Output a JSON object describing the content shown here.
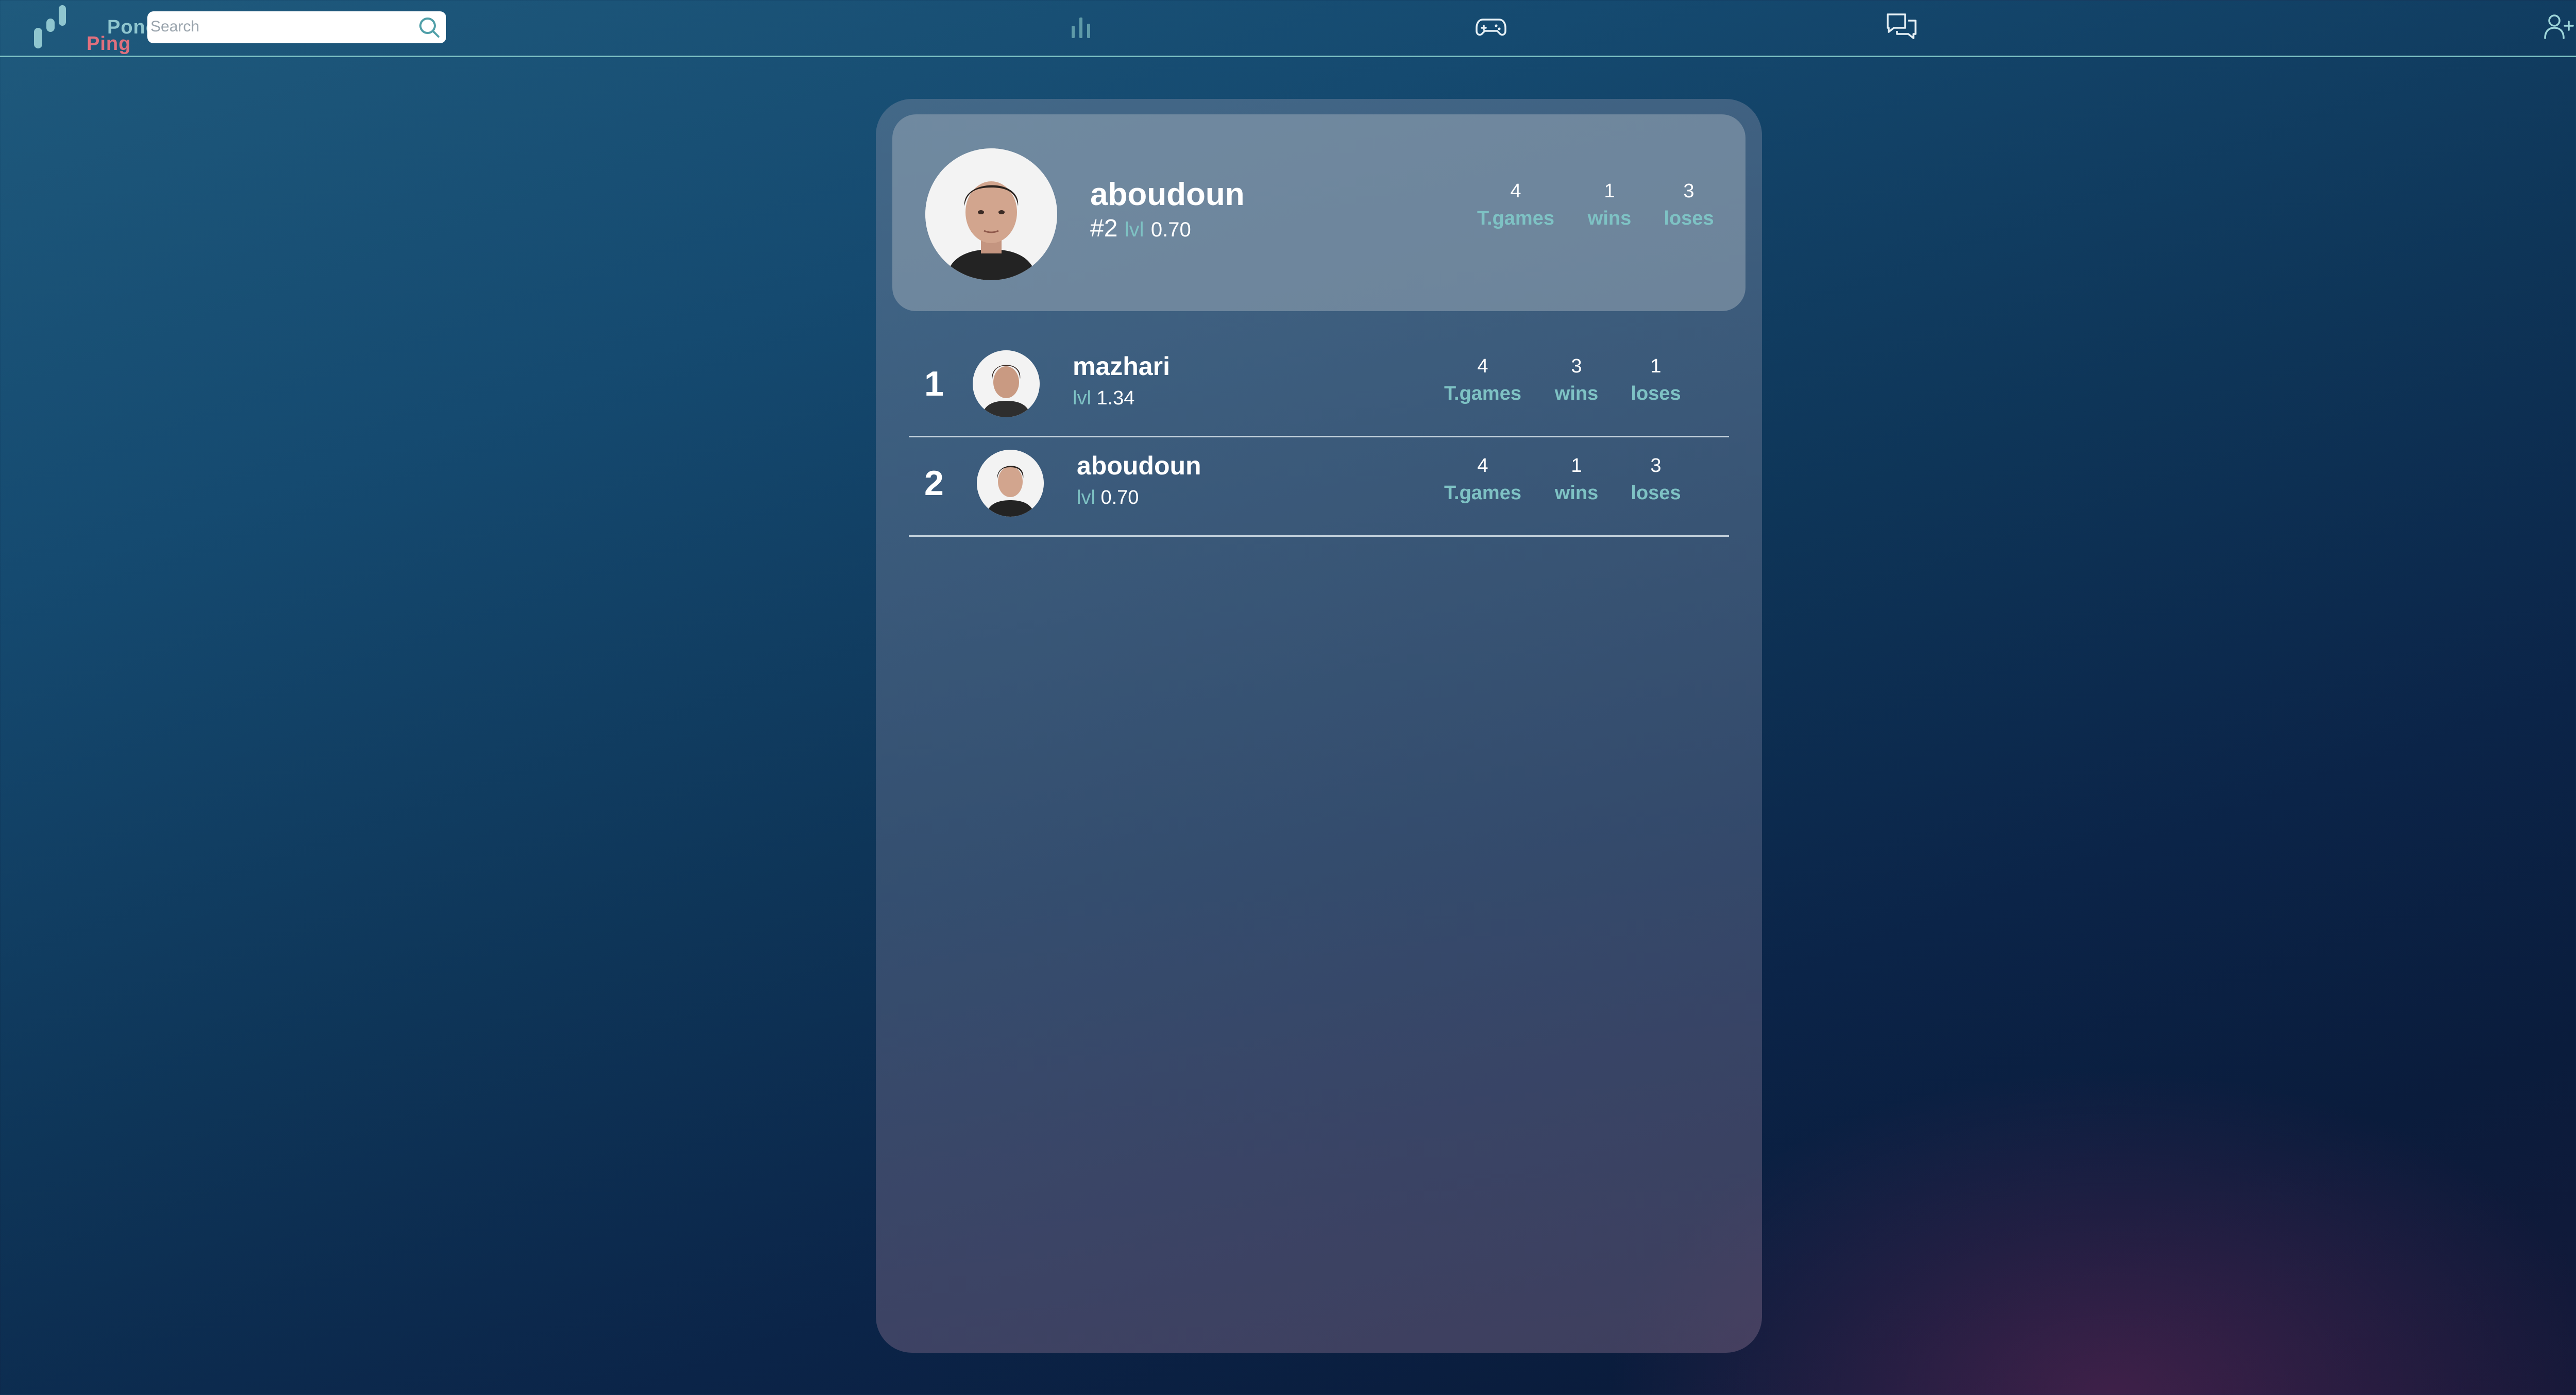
{
  "brand": {
    "line1": "Pong",
    "line2": "Ping"
  },
  "search": {
    "placeholder": "Search"
  },
  "nav": {
    "icons": [
      "stats-icon",
      "gamepad-icon",
      "chat-icon",
      "add-friend-icon",
      "user-avatar"
    ]
  },
  "me": {
    "name": "aboudoun",
    "rank": "#2",
    "lvl_label": "lvl",
    "lvl": "0.70",
    "stats": {
      "games": "4",
      "wins": "1",
      "loses": "3"
    }
  },
  "labels": {
    "games": "T.games",
    "wins": "wins",
    "loses": "loses"
  },
  "leaderboard": [
    {
      "rank": "1",
      "name": "mazhari",
      "lvl_label": "lvl",
      "lvl": "1.34",
      "games": "4",
      "wins": "3",
      "loses": "1"
    },
    {
      "rank": "2",
      "name": "aboudoun",
      "lvl_label": "lvl",
      "lvl": "0.70",
      "games": "4",
      "wins": "1",
      "loses": "3"
    }
  ],
  "colors": {
    "accent": "#7ec2c4",
    "brand_pink": "#e0707e",
    "brand_teal": "#8fc6cf"
  }
}
